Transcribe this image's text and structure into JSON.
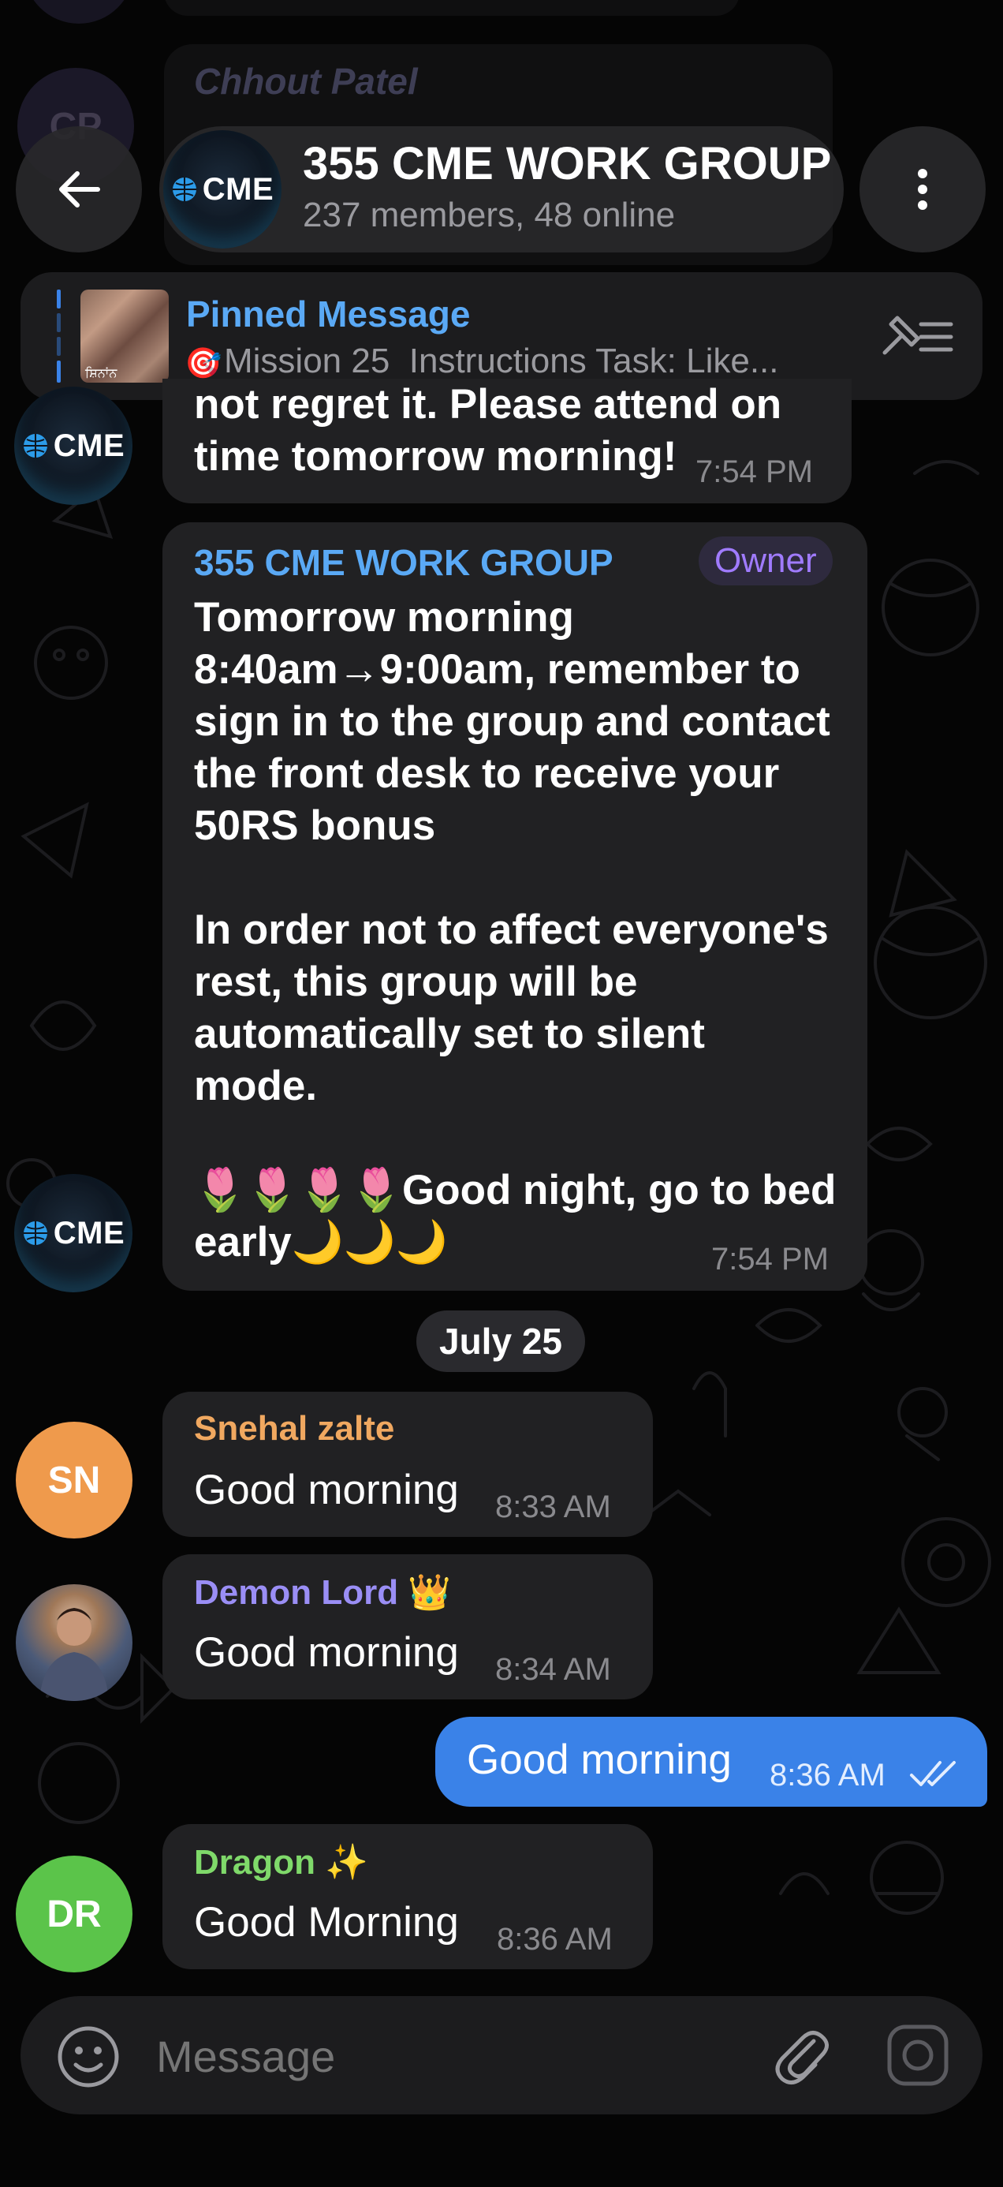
{
  "header": {
    "title": "355 CME WORK GROUP",
    "subtitle": "237 members, 48 online",
    "avatar_text": "CME"
  },
  "background_peek": {
    "sender": "Chhout Patel",
    "avatar_initials": "CP"
  },
  "pinned": {
    "label": "Pinned Message",
    "mission": "Mission 25",
    "preview": "Instructions Task: Like...",
    "thumb_caption": "ਸ਼ਿਨਾਂਨ"
  },
  "messages": {
    "m1": {
      "line1": "not regret it. Please attend on",
      "line2": "time tomorrow morning!",
      "time": "7:54 PM",
      "avatar_text": "CME"
    },
    "m2": {
      "sender": "355 CME WORK GROUP",
      "badge": "Owner",
      "para1": [
        "Tomorrow morning",
        "8:40am→9:00am, remember to",
        "sign in to the group and contact",
        "the front desk to receive your",
        "50RS bonus"
      ],
      "para2": [
        "In order not to affect everyone's",
        "rest, this group will be",
        "automatically set to silent",
        "mode."
      ],
      "para3_line1": "🌷🌷🌷🌷Good night, go to bed",
      "para3_line2": "early🌙🌙🌙",
      "time": "7:54 PM",
      "avatar_text": "CME"
    },
    "date_divider": "July 25",
    "m3": {
      "sender": "Snehal zalte",
      "text": "Good morning",
      "time": "8:33 AM",
      "initials": "SN",
      "name_color": "#f0a860",
      "avatar_color": "#ef9a4c"
    },
    "m4": {
      "sender": "Demon Lord 👑",
      "text": "Good morning",
      "time": "8:34 AM",
      "name_color": "#9a8ef5"
    },
    "m5": {
      "text": "Good morning",
      "time": "8:36 AM"
    },
    "m6": {
      "sender": "Dragon ✨",
      "text": "Good Morning",
      "time": "8:36 AM",
      "initials": "DR",
      "name_color": "#7fd96a",
      "avatar_color": "#5bc44a"
    }
  },
  "input": {
    "placeholder": "Message"
  },
  "colors": {
    "accent": "#3a82e8",
    "owner_badge": "#a07bff",
    "group_name": "#5aa9f5"
  }
}
